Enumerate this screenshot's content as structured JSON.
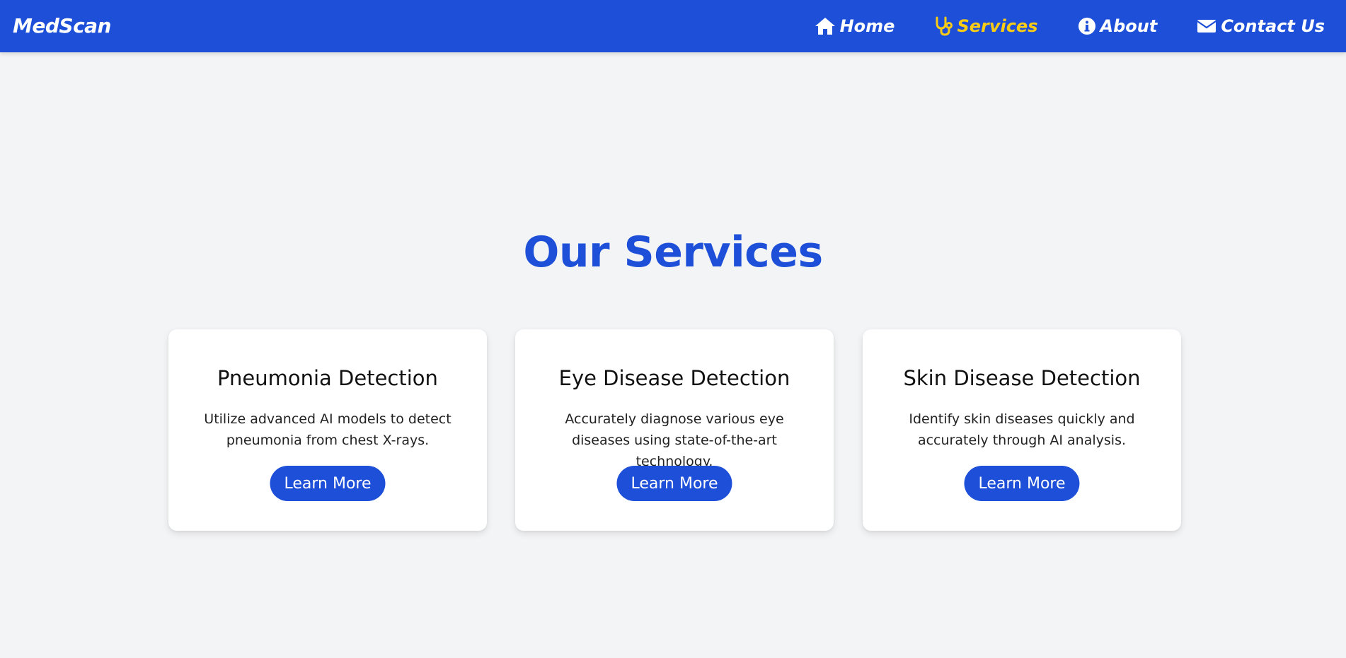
{
  "brand": {
    "name": "MedScan"
  },
  "nav": {
    "items": [
      {
        "label": "Home",
        "icon": "home-icon",
        "active": false
      },
      {
        "label": "Services",
        "icon": "stethoscope-icon",
        "active": true
      },
      {
        "label": "About",
        "icon": "info-icon",
        "active": false
      },
      {
        "label": "Contact Us",
        "icon": "envelope-icon",
        "active": false
      }
    ]
  },
  "main": {
    "heading": "Our Services",
    "cards": [
      {
        "title": "Pneumonia Detection",
        "description": "Utilize advanced AI models to detect pneumonia from chest X-rays.",
        "button": "Learn More"
      },
      {
        "title": "Eye Disease Detection",
        "description": "Accurately diagnose various eye diseases using state-of-the-art technology.",
        "button": "Learn More"
      },
      {
        "title": "Skin Disease Detection",
        "description": "Identify skin diseases quickly and accurately through AI analysis.",
        "button": "Learn More"
      }
    ]
  },
  "colors": {
    "primary": "#1d4fd8",
    "active_nav": "#facc15",
    "background": "#f3f4f6",
    "card": "#ffffff"
  }
}
